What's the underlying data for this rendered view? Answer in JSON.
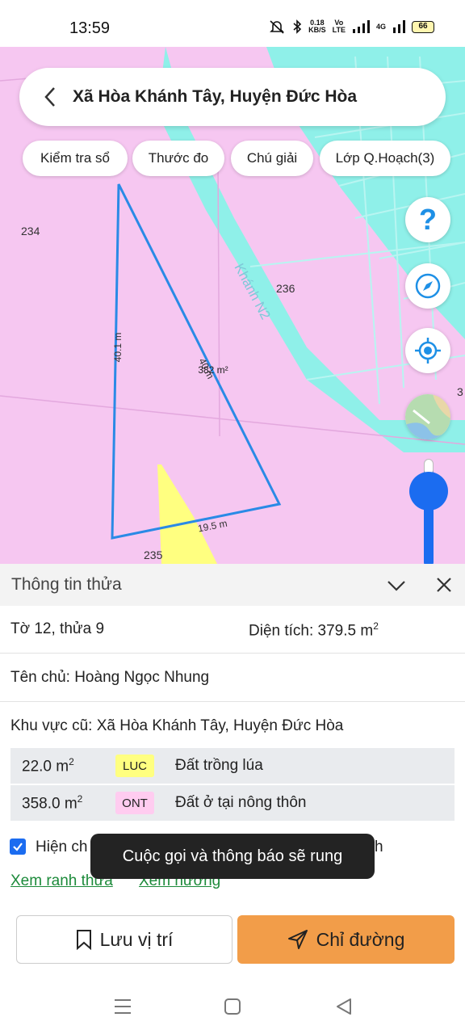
{
  "status_bar": {
    "time": "13:59",
    "net_speed_value": "0.18",
    "net_speed_unit": "KB/S",
    "volte_top": "Vo",
    "volte_bottom": "LTE",
    "network": "4G",
    "battery": "66"
  },
  "search": {
    "title": "Xã Hòa Khánh Tây, Huyện Đức Hòa"
  },
  "chips": [
    {
      "label": "Kiểm tra sổ"
    },
    {
      "label": "Thước đo"
    },
    {
      "label": "Chú giải"
    },
    {
      "label": "Lớp Q.Hoạch(3)"
    }
  ],
  "map": {
    "parcel_labels": [
      "234",
      "236",
      "235",
      "3"
    ],
    "road_label": "Khánh N2",
    "edge_left": "40.1 m",
    "edge_right": "40 m",
    "edge_bottom": "19.5 m",
    "area_label": "382 m²",
    "help_symbol": "?",
    "colors": {
      "residential": "#f6c7f1",
      "road": "#8ff0e9",
      "rice": "#ffff80",
      "parcel_outline": "#2a8ae6"
    }
  },
  "panel": {
    "title": "Thông tin thửa",
    "sheet_parcel": "Tờ 12, thửa 9",
    "area_label": "Diện tích: 379.5 m",
    "area_sup": "2",
    "owner": "Tên chủ: Hoàng Ngọc Nhung",
    "old_area": "Khu vực cũ: Xã Hòa Khánh Tây, Huyện Đức Hòa",
    "land_uses": [
      {
        "area": "22.0 m",
        "sup": "2",
        "code": "LUC",
        "description": "Đất trồng lúa"
      },
      {
        "area": "358.0 m",
        "sup": "2",
        "code": "ONT",
        "description": "Đất ở tại nông thôn"
      }
    ],
    "checkbox_label_start": "Hiện ch",
    "checkbox_label_end": "h",
    "checkbox_checked": true,
    "links": [
      "Xem ranh thửa",
      "Xem hướng"
    ],
    "toast": "Cuộc gọi và thông báo sẽ rung",
    "save_button": "Lưu vị trí",
    "route_button": "Chỉ đường"
  }
}
